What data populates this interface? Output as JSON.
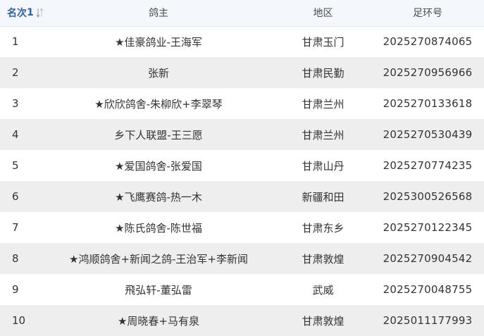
{
  "columns": {
    "rank": "名次",
    "sort_indicator": "1",
    "owner": "鸽主",
    "region": "地区",
    "ring": "足环号"
  },
  "rows": [
    {
      "rank": "1",
      "owner": "★佳豪鸽业-王海军",
      "region": "甘肃玉门",
      "ring": "2025270874065"
    },
    {
      "rank": "2",
      "owner": "张新",
      "region": "甘肃民勤",
      "ring": "2025270956966"
    },
    {
      "rank": "3",
      "owner": "★欣欣鸽舍-朱柳欣+李翠琴",
      "region": "甘肃兰州",
      "ring": "2025270133618"
    },
    {
      "rank": "4",
      "owner": "乡下人联盟-王三愿",
      "region": "甘肃兰州",
      "ring": "2025270530439"
    },
    {
      "rank": "5",
      "owner": "★爱国鸽舍-张爱国",
      "region": "甘肃山丹",
      "ring": "2025270774235"
    },
    {
      "rank": "6",
      "owner": "★飞鹰赛鸽-热一木",
      "region": "新疆和田",
      "ring": "2025300526568"
    },
    {
      "rank": "7",
      "owner": "★陈氏鸽舍-陈世福",
      "region": "甘肃东乡",
      "ring": "2025270122345"
    },
    {
      "rank": "8",
      "owner": "★鸿顺鸽舍+新闻之鸽-王治军+李新闻",
      "region": "甘肃敦煌",
      "ring": "2025270904542"
    },
    {
      "rank": "9",
      "owner": "飛弘轩-董弘雷",
      "region": "武威",
      "ring": "2025270048755"
    },
    {
      "rank": "10",
      "owner": "★周晓春+马有泉",
      "region": "甘肃敦煌",
      "ring": "2025011177993"
    }
  ],
  "colors": {
    "header_bg": "#f4f7fb",
    "header_accent": "#2f5fa8",
    "row_alt_bg": "#eeeeee"
  }
}
